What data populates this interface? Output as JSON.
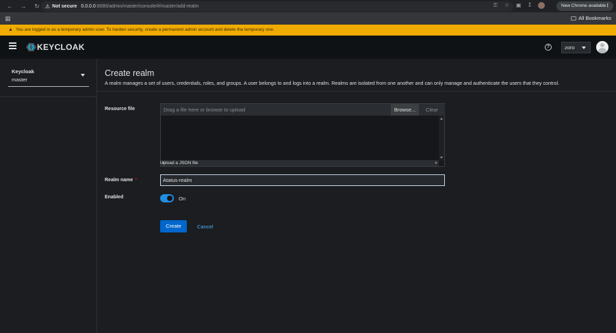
{
  "browser": {
    "security_label": "Not secure",
    "url_host": "0.0.0.0",
    "url_rest": ":8080/admin/master/console/#/master/add-realm",
    "update_label": "New Chrome available",
    "bookmarks_label": "All Bookmarks"
  },
  "banner": {
    "text": "You are logged in as a temporary admin user. To harden security, create a permanent admin account and delete the temporary one.",
    "color": "#f0ab00"
  },
  "masthead": {
    "logo_text": "KEYCLOAK",
    "user": "zoro"
  },
  "sidebar": {
    "realm_title": "Keycloak",
    "realm_name": "master"
  },
  "page": {
    "title": "Create realm",
    "description": "A realm manages a set of users, credentials, roles, and groups. A user belongs to and logs into a realm. Realms are isolated from one another and can only manage and authenticate the users that they control."
  },
  "form": {
    "resource_file_label": "Resource file",
    "file_placeholder": "Drag a file here or browse to upload",
    "browse_label": "Browse...",
    "clear_label": "Clear",
    "helper_text": "Upload a JSON file",
    "realm_name_label": "Realm name",
    "required_mark": "*",
    "realm_name_value": "Atatus-realm",
    "enabled_label": "Enabled",
    "enabled_state": "On",
    "create_label": "Create",
    "cancel_label": "Cancel"
  },
  "colors": {
    "primary": "#0066cc",
    "link": "#4db2ff",
    "toggle_on": "#1f8fe5"
  }
}
